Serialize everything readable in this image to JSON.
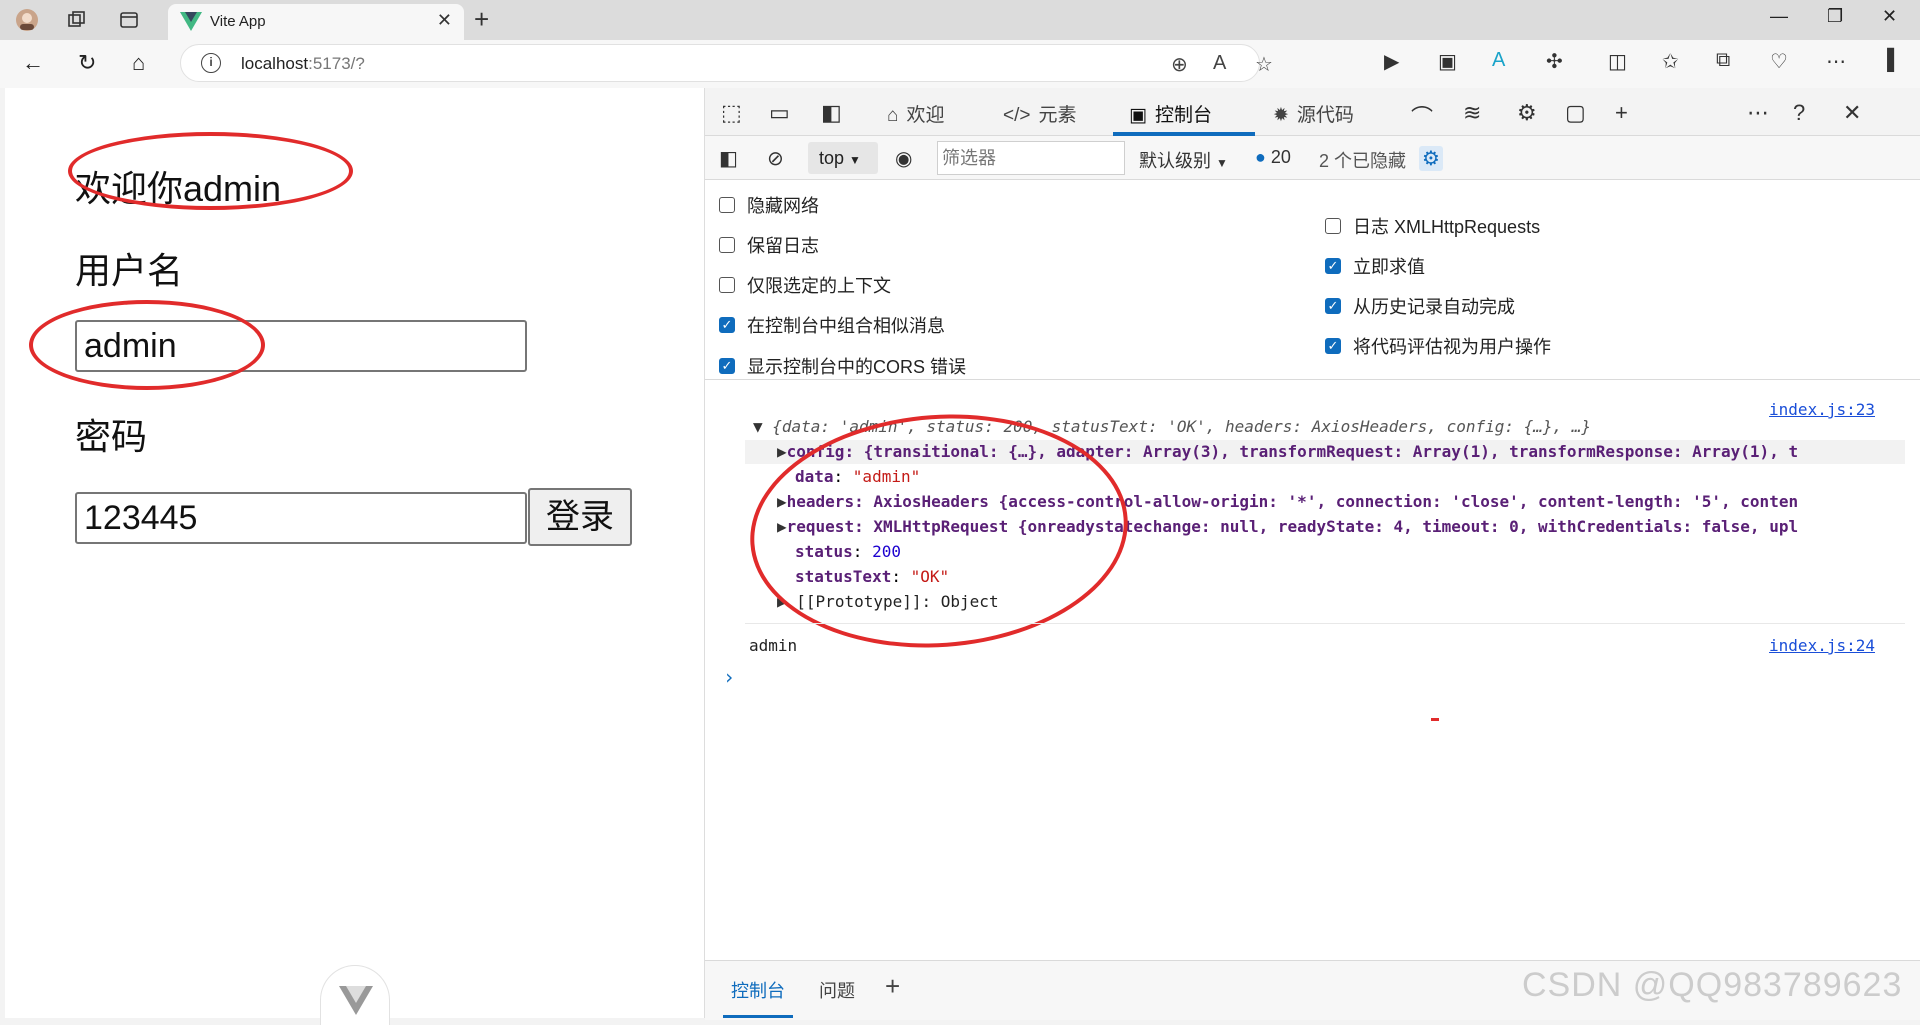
{
  "browser": {
    "tab_title": "Vite App",
    "url_host": "localhost",
    "url_rest": ":5173/?"
  },
  "page": {
    "welcome": "欢迎你admin",
    "username_label": "用户名",
    "username_value": "admin",
    "password_label": "密码",
    "password_value": "123445",
    "login_button": "登录"
  },
  "devtools": {
    "tabs": [
      {
        "label": "欢迎"
      },
      {
        "label": "元素"
      },
      {
        "label": "控制台"
      },
      {
        "label": "源代码"
      }
    ],
    "toolbar": {
      "context": "top",
      "filter_placeholder": "筛选器",
      "level": "默认级别",
      "message_count": "20",
      "hidden": "2 个已隐藏"
    },
    "settings_left": [
      {
        "label": "隐藏网络",
        "checked": false
      },
      {
        "label": "保留日志",
        "checked": false
      },
      {
        "label": "仅限选定的上下文",
        "checked": false
      },
      {
        "label": "在控制台中组合相似消息",
        "checked": true
      },
      {
        "label": "显示控制台中的CORS 错误",
        "checked": true
      }
    ],
    "settings_right": [
      {
        "label": "日志 XMLHttpRequests",
        "checked": false
      },
      {
        "label": "立即求值",
        "checked": true
      },
      {
        "label": "从历史记录自动完成",
        "checked": true
      },
      {
        "label": "将代码评估视为用户操作",
        "checked": true
      }
    ],
    "console": {
      "source1": "index.js:23",
      "source2": "index.js:24",
      "summary": "{data: 'admin', status: 200, statusText: 'OK', headers: AxiosHeaders, config: {…}, …}",
      "config_line": "config: {transitional: {…}, adapter: Array(3), transformRequest: Array(1), transformResponse: Array(1), t",
      "data_key": "data",
      "data_val": "\"admin\"",
      "headers_line": "headers: AxiosHeaders {access-control-allow-origin: '*', connection: 'close', content-length: '5', conten",
      "request_line": "request: XMLHttpRequest {onreadystatechange: null, readyState: 4, timeout: 0, withCredentials: false, upl",
      "status_key": "status",
      "status_val": "200",
      "statusText_key": "statusText",
      "statusText_val": "\"OK\"",
      "proto_line": "[[Prototype]]: Object",
      "log2": "admin"
    },
    "bottom_tabs": [
      "控制台",
      "问题"
    ]
  },
  "watermark": "CSDN @QQ983789623",
  "colors": {
    "accent": "#0f6cbd",
    "annotation_red": "#e12b2b"
  }
}
